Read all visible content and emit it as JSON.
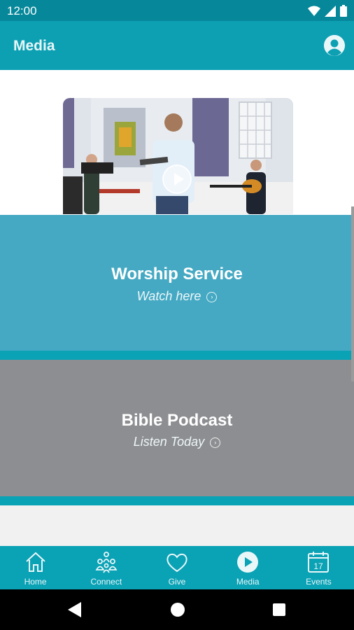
{
  "status_bar": {
    "time": "12:00",
    "icons": [
      "wifi-icon",
      "cellular-signal-icon",
      "battery-icon"
    ]
  },
  "app_bar": {
    "title": "Media",
    "profile_icon": "account-circle-icon"
  },
  "cards": [
    {
      "title": "Worship Service",
      "subtitle": "Watch here",
      "thumbnail_icon": "play-icon",
      "color": "#45a9c3"
    },
    {
      "title": "Bible Podcast",
      "subtitle": "Listen Today",
      "color": "#8d8e91"
    }
  ],
  "bottom_nav": {
    "items": [
      {
        "label": "Home",
        "icon": "home-icon"
      },
      {
        "label": "Connect",
        "icon": "people-icon"
      },
      {
        "label": "Give",
        "icon": "heart-icon"
      },
      {
        "label": "Media",
        "icon": "play-circle-icon",
        "selected": true
      },
      {
        "label": "Events",
        "icon": "calendar-icon",
        "day": "17"
      }
    ]
  },
  "colors": {
    "primary": "#0aa2b5",
    "status_bar": "#06889a",
    "worship_card": "#45a9c3",
    "podcast_card": "#8d8e91"
  }
}
